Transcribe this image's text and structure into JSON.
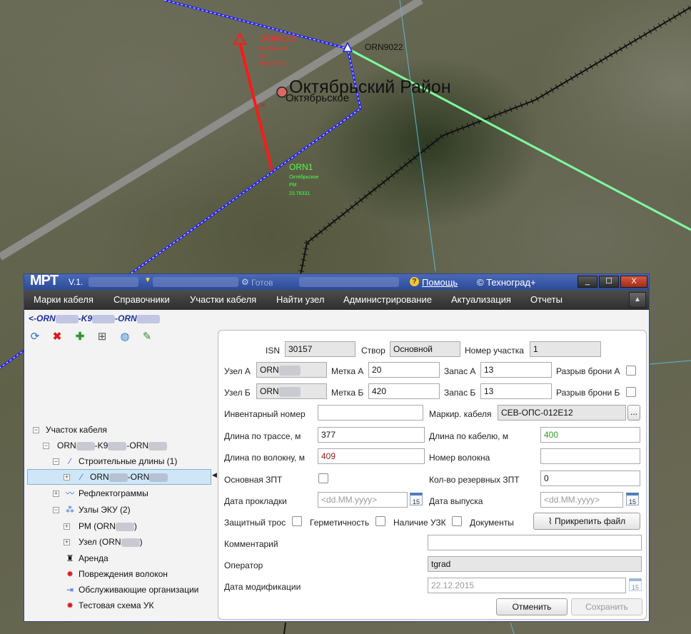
{
  "map": {
    "district_label": "Октябрьский Район",
    "village_label": "Октябрьское",
    "node_a": {
      "id": "ORN0010",
      "line1": "Октябрьское",
      "line2": "Сук",
      "line3": "05010.00010"
    },
    "node_b": {
      "id": "ORN1",
      "line1": "Октябрьское",
      "line2": "РМ",
      "line3": "23.76331"
    },
    "node_c": {
      "id": "ORN9022"
    },
    "small_label": "OK",
    "colors": {
      "route": "#1e1eff",
      "cable": "#ff1a1a",
      "green_line": "#7dffa0",
      "railway": "#111111",
      "road": "#8d8d8a"
    }
  },
  "window": {
    "logo": "MPT",
    "version": "V.1.",
    "status": "Готов",
    "help": "Помощь",
    "copyright": "© Техноград+",
    "buttons": {
      "minimize": "_",
      "maximize": "☐",
      "close": "X"
    }
  },
  "menu": [
    "Марки кабеля",
    "Справочники",
    "Участки кабеля",
    "Найти узел",
    "Администрирование",
    "Актуализация",
    "Отчеты"
  ],
  "breadcrumb": {
    "p1": "<-ORN",
    "p2": "-K9",
    "p3": "-ORN"
  },
  "toolbar": {
    "icons": [
      "refresh-icon",
      "delete-icon",
      "add-icon",
      "structure-icon",
      "globe-icon",
      "edit-icon"
    ]
  },
  "tree": {
    "root": "Участок кабеля",
    "section": {
      "p1": "ORN",
      "p2": "-K9",
      "p3": "-ORN"
    },
    "build_lengths": "Строительные длины (1)",
    "selected": {
      "p1": "ORN",
      "p2": "-ORN"
    },
    "reflectograms": "Рефлектограммы",
    "eku_nodes": "Узлы ЭКУ (2)",
    "rm_node": "РМ (ORN",
    "uzel_node": "Узел (ORN",
    "close_paren": ")",
    "rent": "Аренда",
    "damage": "Повреждения волокон",
    "orgs": "Обслуживающие организации",
    "test_scheme": "Тестовая схема УК"
  },
  "form": {
    "isn_label": "ISN",
    "isn": "30157",
    "stvor_label": "Створ",
    "stvor": "Основной",
    "section_no_label": "Номер участка",
    "section_no": "1",
    "node_a_label": "Узел А",
    "node_a": "ORN",
    "mark_a_label": "Метка А",
    "mark_a": "20",
    "reserve_a_label": "Запас А",
    "reserve_a": "13",
    "armor_a_label": "Разрыв брони А",
    "node_b_label": "Узел Б",
    "node_b": "ORN",
    "mark_b_label": "Метка Б",
    "mark_b": "420",
    "reserve_b_label": "Запас Б",
    "reserve_b": "13",
    "armor_b_label": "Разрыв брони Б",
    "inventory_label": "Инвентарный номер",
    "inventory": "",
    "cable_mark_label": "Маркир. кабеля",
    "cable_mark": "СЕВ-ОПС-012Е12",
    "more_btn": "...",
    "route_len_label": "Длина по трассе, м",
    "route_len": "377",
    "cable_len_label": "Длина по кабелю, м",
    "cable_len": "400",
    "fiber_len_label": "Длина по волокну, м",
    "fiber_len": "409",
    "fiber_no_label": "Номер волокна",
    "fiber_no": "",
    "main_zpt_label": "Основная ЗПТ",
    "reserve_zpt_label": "Кол-во резервных ЗПТ",
    "reserve_zpt": "0",
    "lay_date_label": "Дата прокладки",
    "date_placeholder": "<dd.MM.yyyy>",
    "release_date_label": "Дата выпуска",
    "cal_day": "15",
    "guard_label": "Защитный трос",
    "seal_label": "Герметичность",
    "uzk_label": "Наличие УЗК",
    "docs_label": "Документы",
    "attach_btn": "Прикрепить файл",
    "comment_label": "Комментарий",
    "comment": "",
    "operator_label": "Оператор",
    "operator": "tgrad",
    "mod_date_label": "Дата модификации",
    "mod_date": "22.12.2015",
    "cancel_btn": "Отменить",
    "save_btn": "Сохранить",
    "colors": {
      "cable_len": "#2a9a2a",
      "fiber_len": "#9a1a1a"
    }
  }
}
